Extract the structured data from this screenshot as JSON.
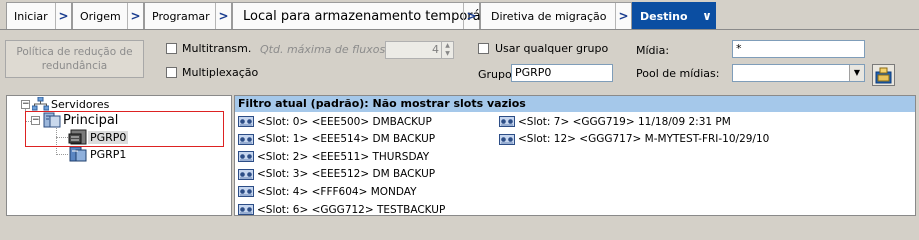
{
  "tabs": [
    {
      "label": "Iniciar"
    },
    {
      "label": "Origem"
    },
    {
      "label": "Programar"
    },
    {
      "label": "Local para armazenamento temporário"
    },
    {
      "label": "Diretiva de migração"
    },
    {
      "label": "Destino",
      "active": true
    }
  ],
  "options": {
    "policy_button": "Política de redução de redundância",
    "multistream_label": "Multitransm.",
    "multistream_checked": false,
    "max_streams_label": "Qtd. máxima de fluxos",
    "max_streams_value": "4",
    "multiplex_label": "Multiplexação",
    "multiplex_checked": false,
    "any_group_label": "Usar qualquer grupo",
    "any_group_checked": false,
    "group_label": "Grupo",
    "group_value": "PGRP0",
    "media_label": "Mídia:",
    "media_value": "*",
    "media_pool_label": "Pool de mídias:",
    "media_pool_value": ""
  },
  "tree": {
    "root": "Servidores",
    "server": "Principal",
    "groups": [
      "PGRP0",
      "PGRP1"
    ],
    "selected": "PGRP0"
  },
  "slot_list": {
    "filter_header": "Filtro atual (padrão):  Não mostrar slots vazios",
    "column1": [
      "<Slot:  0> <EEE500> DMBACKUP",
      "<Slot:  1> <EEE514> DM BACKUP",
      "<Slot:  2> <EEE511> THURSDAY",
      "<Slot:  3> <EEE512> DM BACKUP",
      "<Slot:  4> <FFF604> MONDAY",
      "<Slot:  6> <GGG712> TESTBACKUP"
    ],
    "column2": [
      "<Slot:  7> <GGG719> 11/18/09 2:31 PM",
      "<Slot: 12> <GGG717> M-MYTEST-FRI-10/29/10"
    ]
  },
  "colors": {
    "active_tab": "#0b4ea2",
    "filter_header_bg": "#a5c8ea",
    "highlight_box": "#dd2222"
  }
}
